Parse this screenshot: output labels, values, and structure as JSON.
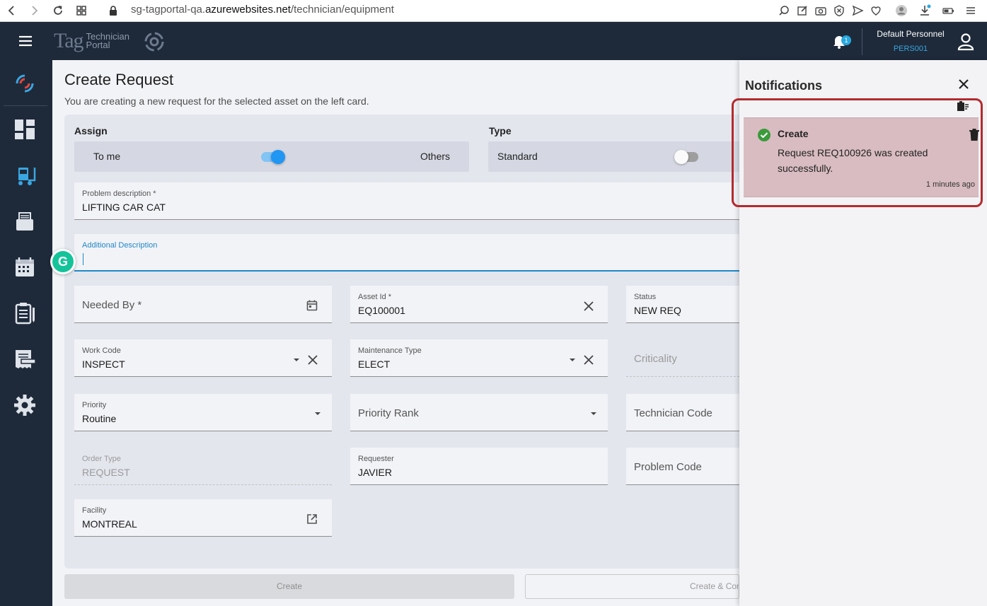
{
  "browser": {
    "url_prefix": "sg-tagportal-qa.",
    "url_host": "azurewebsites.net",
    "url_path": "/technician/equipment"
  },
  "header": {
    "brand_tag": "Tag",
    "brand_line1": "Technician",
    "brand_line2": "Portal",
    "notification_count": "1",
    "user_name": "Default Personnel",
    "user_code": "PERS001"
  },
  "sidebar": {
    "items": [
      "logo-icon",
      "dashboard-icon",
      "equipment-icon",
      "inbox-icon",
      "calendar-icon",
      "checklist-icon",
      "reports-icon",
      "settings-icon"
    ]
  },
  "page": {
    "title": "Create Request",
    "subtitle": "You are creating a new request for the selected asset on the left card."
  },
  "form": {
    "assign": {
      "label": "Assign",
      "left": "To me",
      "right": "Others",
      "toggled_right": false
    },
    "type": {
      "label": "Type",
      "left": "Standard",
      "toggled": false
    },
    "problem_description": {
      "label": "Problem description *",
      "value": "LIFTING CAR CAT"
    },
    "additional_description": {
      "label": "Additional Description",
      "value": ""
    },
    "needed_by": {
      "placeholder": "Needed By *"
    },
    "asset_id": {
      "label": "Asset Id *",
      "value": "EQ100001"
    },
    "status": {
      "label": "Status",
      "value": "NEW REQ"
    },
    "work_code": {
      "label": "Work Code",
      "value": "INSPECT"
    },
    "maintenance_type": {
      "label": "Maintenance Type",
      "value": "ELECT"
    },
    "criticality": {
      "placeholder": "Criticality"
    },
    "priority": {
      "label": "Priority",
      "value": "Routine"
    },
    "priority_rank": {
      "placeholder": "Priority Rank"
    },
    "technician_code": {
      "placeholder": "Technician Code"
    },
    "order_type": {
      "label": "Order Type",
      "value": "REQUEST"
    },
    "requester": {
      "label": "Requester",
      "value": "JAVIER"
    },
    "problem_code": {
      "placeholder": "Problem Code"
    },
    "facility": {
      "label": "Facility",
      "value": "MONTREAL"
    }
  },
  "buttons": {
    "create": "Create",
    "create_and_continue": "Create & Con"
  },
  "notifications": {
    "title": "Notifications",
    "items": [
      {
        "title": "Create",
        "message": "Request REQ100926 was created successfully.",
        "time": "1 minutes ago",
        "status": "success"
      }
    ]
  },
  "colors": {
    "sidebar_bg": "#1e2a3a",
    "accent": "#1e88c8",
    "toggle_on": "#2196f3",
    "success": "#3b9b3b",
    "notification_card": "#d8bcc1",
    "highlight": "#b22a2e"
  }
}
